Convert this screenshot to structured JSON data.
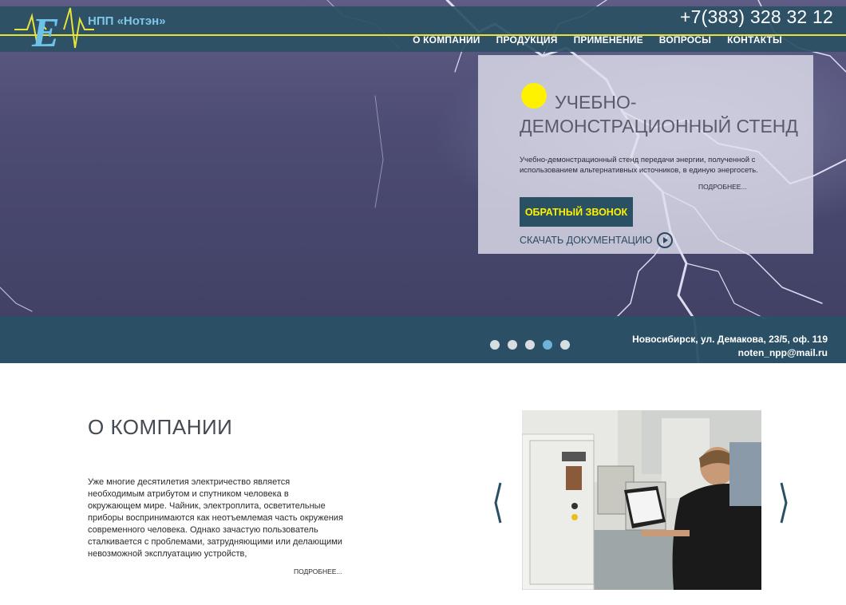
{
  "header": {
    "company_name": "НПП «Нотэн»",
    "logo_letter": "E",
    "phone": "+7(383) 328 32 12",
    "nav": [
      "О КОМПАНИИ",
      "ПРОДУКЦИЯ",
      "ПРИМЕНЕНИЕ",
      "ВОПРОСЫ",
      "КОНТАКТЫ"
    ]
  },
  "slide": {
    "title": "Учебно-демонстрационный стенд",
    "text": "Учебно-демонстрационный стенд передачи энергии, полученной с использованием альтернативных источников, в единую энергосеть.",
    "more_label": "ПОДРОБНЕЕ...",
    "callback_label": "ОБРАТНЫЙ ЗВОНОК",
    "download_label": "СКАЧАТЬ ДОКУМЕНТАЦИЮ"
  },
  "slider": {
    "total": 5,
    "active": 4
  },
  "contacts": {
    "address": "Новосибирск, ул. Демакова, 23/5, оф. 119",
    "email": "noten_npp@mail.ru"
  },
  "about": {
    "title": "О КОМПАНИИ",
    "text": "Уже многие десятилетия электричество является необходимым атрибутом и спутником человека в окружающем мире. Чайник, электроплита, осветительные приборы воспринимаются как неотъемлемая часть окружения современного человека. Однако зачастую пользователь сталкивается с проблемами, затрудняющими или делающими невозможной эксплуатацию устройств,",
    "more_label": "ПОДРОБНЕЕ..."
  },
  "colors": {
    "accent": "#fff200",
    "band": "#2a5064",
    "link_blue": "#7fc6e8"
  }
}
